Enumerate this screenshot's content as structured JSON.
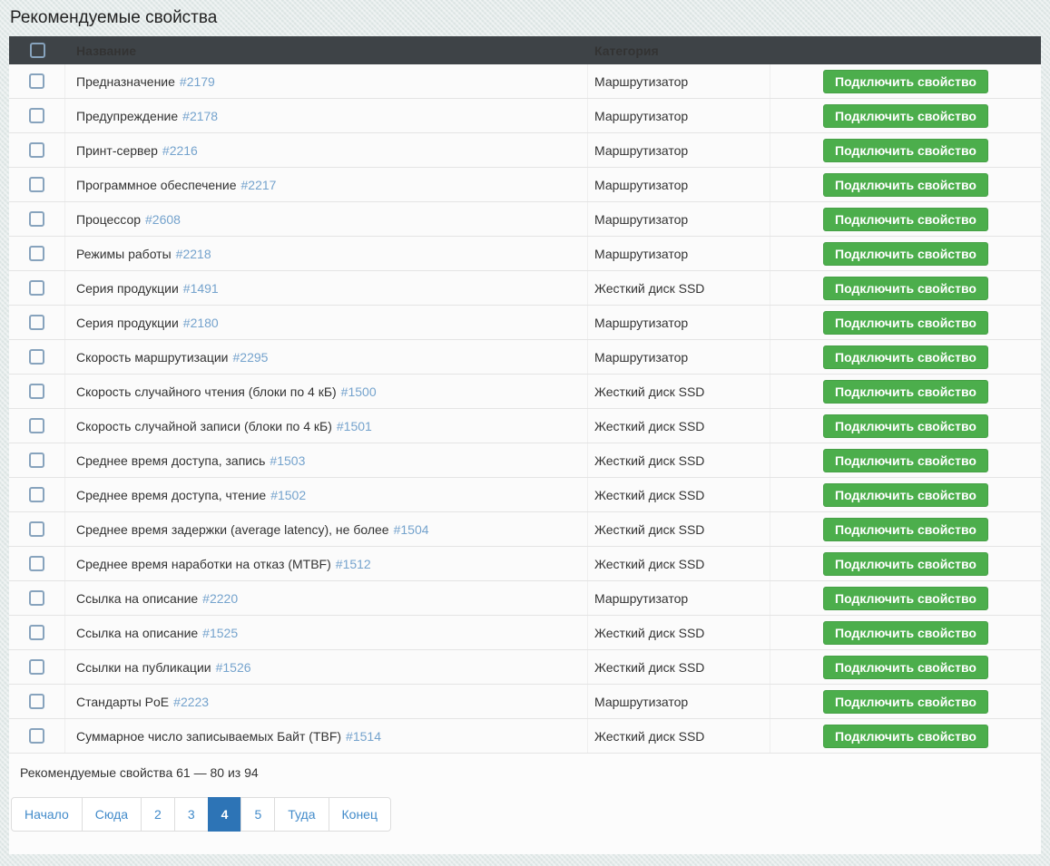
{
  "page": {
    "title": "Рекомендуемые свойства"
  },
  "table": {
    "columns": {
      "name": "Название",
      "category": "Категория"
    },
    "action_label": "Подключить свойство",
    "rows": [
      {
        "name": "Предназначение",
        "id": "#2179",
        "category": "Маршрутизатор"
      },
      {
        "name": "Предупреждение",
        "id": "#2178",
        "category": "Маршрутизатор"
      },
      {
        "name": "Принт-сервер",
        "id": "#2216",
        "category": "Маршрутизатор"
      },
      {
        "name": "Программное обеспечение",
        "id": "#2217",
        "category": "Маршрутизатор"
      },
      {
        "name": "Процессор",
        "id": "#2608",
        "category": "Маршрутизатор"
      },
      {
        "name": "Режимы работы",
        "id": "#2218",
        "category": "Маршрутизатор"
      },
      {
        "name": "Серия продукции",
        "id": "#1491",
        "category": "Жесткий диск SSD"
      },
      {
        "name": "Серия продукции",
        "id": "#2180",
        "category": "Маршрутизатор"
      },
      {
        "name": "Скорость маршрутизации",
        "id": "#2295",
        "category": "Маршрутизатор"
      },
      {
        "name": "Скорость случайного чтения (блоки по 4 кБ)",
        "id": "#1500",
        "category": "Жесткий диск SSD"
      },
      {
        "name": "Скорость случайной записи (блоки по 4 кБ)",
        "id": "#1501",
        "category": "Жесткий диск SSD"
      },
      {
        "name": "Среднее время доступа, запись",
        "id": "#1503",
        "category": "Жесткий диск SSD"
      },
      {
        "name": "Среднее время доступа, чтение",
        "id": "#1502",
        "category": "Жесткий диск SSD"
      },
      {
        "name": "Среднее время задержки (average latency), не более",
        "id": "#1504",
        "category": "Жесткий диск SSD"
      },
      {
        "name": "Среднее время наработки на отказ (MTBF)",
        "id": "#1512",
        "category": "Жесткий диск SSD"
      },
      {
        "name": "Ссылка на описание",
        "id": "#2220",
        "category": "Маршрутизатор"
      },
      {
        "name": "Ссылка на описание",
        "id": "#1525",
        "category": "Жесткий диск SSD"
      },
      {
        "name": "Ссылки на публикации",
        "id": "#1526",
        "category": "Жесткий диск SSD"
      },
      {
        "name": "Стандарты PoE",
        "id": "#2223",
        "category": "Маршрутизатор"
      },
      {
        "name": "Суммарное число записываемых Байт (TBF)",
        "id": "#1514",
        "category": "Жесткий диск SSD"
      }
    ]
  },
  "footer": {
    "summary": "Рекомендуемые свойства 61 — 80 из 94"
  },
  "pagination": {
    "items": [
      {
        "label": "Начало",
        "active": false
      },
      {
        "label": "Сюда",
        "active": false
      },
      {
        "label": "2",
        "active": false
      },
      {
        "label": "3",
        "active": false
      },
      {
        "label": "4",
        "active": true
      },
      {
        "label": "5",
        "active": false
      },
      {
        "label": "Туда",
        "active": false
      },
      {
        "label": "Конец",
        "active": false
      }
    ]
  },
  "colors": {
    "header_bg": "#3e4347",
    "button_green": "#4cae4c",
    "link_blue": "#428bca",
    "id_link_blue": "#75a3cd",
    "active_page_bg": "#2d74b6",
    "checkbox_border": "#87a3bd",
    "page_bg": "#e3eae9"
  }
}
